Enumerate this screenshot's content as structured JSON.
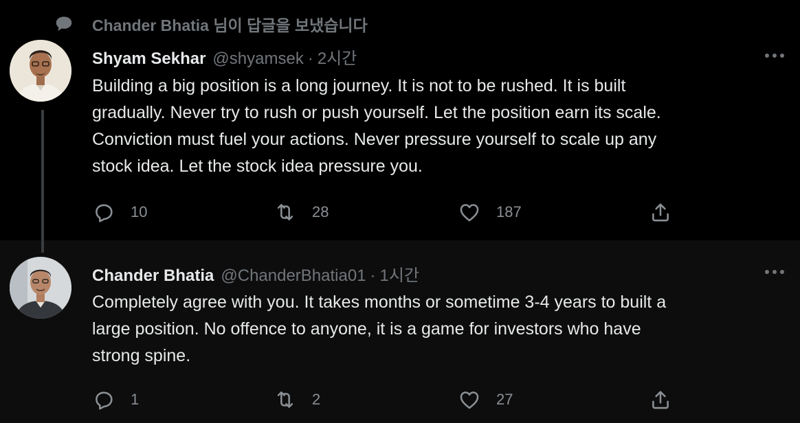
{
  "social_context": {
    "icon": "speech-bubble-icon",
    "text": "Chander Bhatia 님이 답글을 보냈습니다"
  },
  "tweets": [
    {
      "author": {
        "name": "Shyam Sekhar",
        "handle": "@shyamsek",
        "separator": "·",
        "time": "2시간"
      },
      "text": "Building a big position is a long journey. It is not to be rushed. It is built\ngradually. Never try to rush or push yourself. Let the position earn its scale.\nConviction must fuel your actions. Never pressure yourself to scale up any\nstock idea. Let the stock idea pressure you.",
      "stats": {
        "replies": "10",
        "retweets": "28",
        "likes": "187"
      }
    },
    {
      "author": {
        "name": "Chander Bhatia",
        "handle": "@ChanderBhatia01",
        "separator": "·",
        "time": "1시간"
      },
      "text": "Completely agree with you. It takes months or sometime 3-4 years to built a\nlarge position. No offence to anyone, it is a game for investors who have\nstrong spine.",
      "stats": {
        "replies": "1",
        "retweets": "2",
        "likes": "27"
      }
    }
  ],
  "colors": {
    "background": "#000000",
    "reply_background": "#0d0d0d",
    "primary_text": "#e7e9ea",
    "secondary_text": "#71767b"
  }
}
